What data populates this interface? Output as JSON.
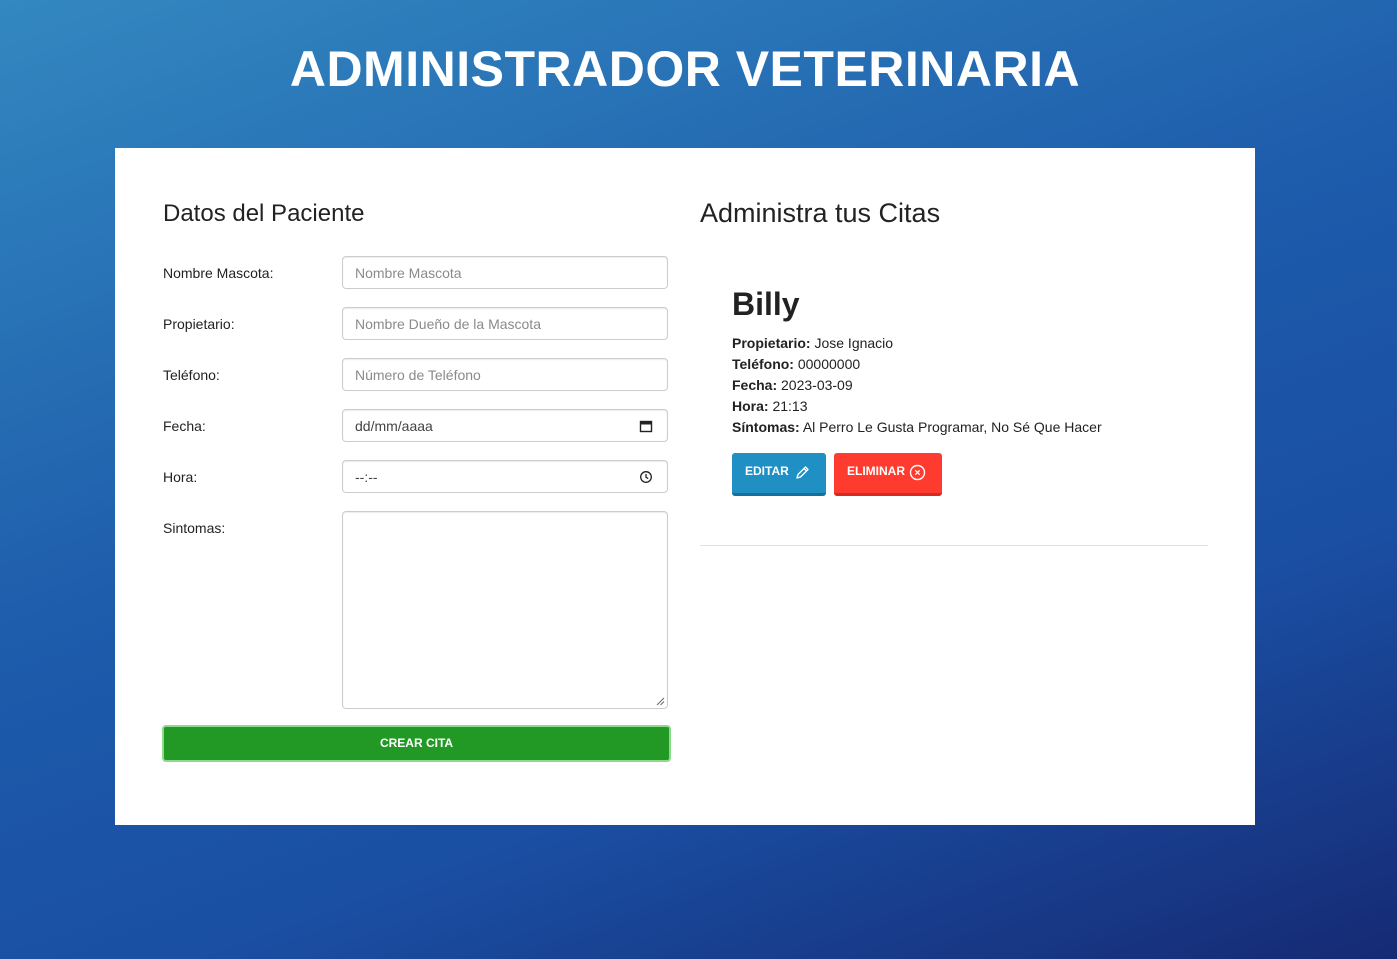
{
  "header": {
    "title": "ADMINISTRADOR VETERINARIA"
  },
  "form": {
    "heading": "Datos del Paciente",
    "fields": [
      {
        "label": "Nombre Mascota:",
        "placeholder": "Nombre Mascota"
      },
      {
        "label": "Propietario:",
        "placeholder": "Nombre Dueño de la Mascota"
      },
      {
        "label": "Teléfono:",
        "placeholder": "Número de Teléfono"
      },
      {
        "label": "Fecha:",
        "value": "dd/mm/aaaa",
        "icon": "calendar-icon"
      },
      {
        "label": "Hora:",
        "value": "--:--",
        "icon": "clock-icon"
      },
      {
        "label": "Sintomas:",
        "value": ""
      }
    ],
    "submit_label": "CREAR CITA"
  },
  "citas": {
    "heading": "Administra tus Citas",
    "items": [
      {
        "name": "Billy",
        "owner_label": "Propietario:",
        "owner": "Jose Ignacio",
        "phone_label": "Teléfono:",
        "phone": "00000000",
        "date_label": "Fecha:",
        "date": "2023-03-09",
        "time_label": "Hora:",
        "time": "21:13",
        "symptoms_label": "Síntomas:",
        "symptoms": "Al Perro Le Gusta Programar, No Sé Que Hacer",
        "edit_label": "EDITAR",
        "edit_icon": "pencil-icon",
        "delete_label": "ELIMINAR",
        "delete_icon": "circle-x-icon"
      }
    ]
  },
  "colors": {
    "submit": "#229925",
    "edit": "#1f8fc4",
    "delete": "#ff3b2f"
  }
}
